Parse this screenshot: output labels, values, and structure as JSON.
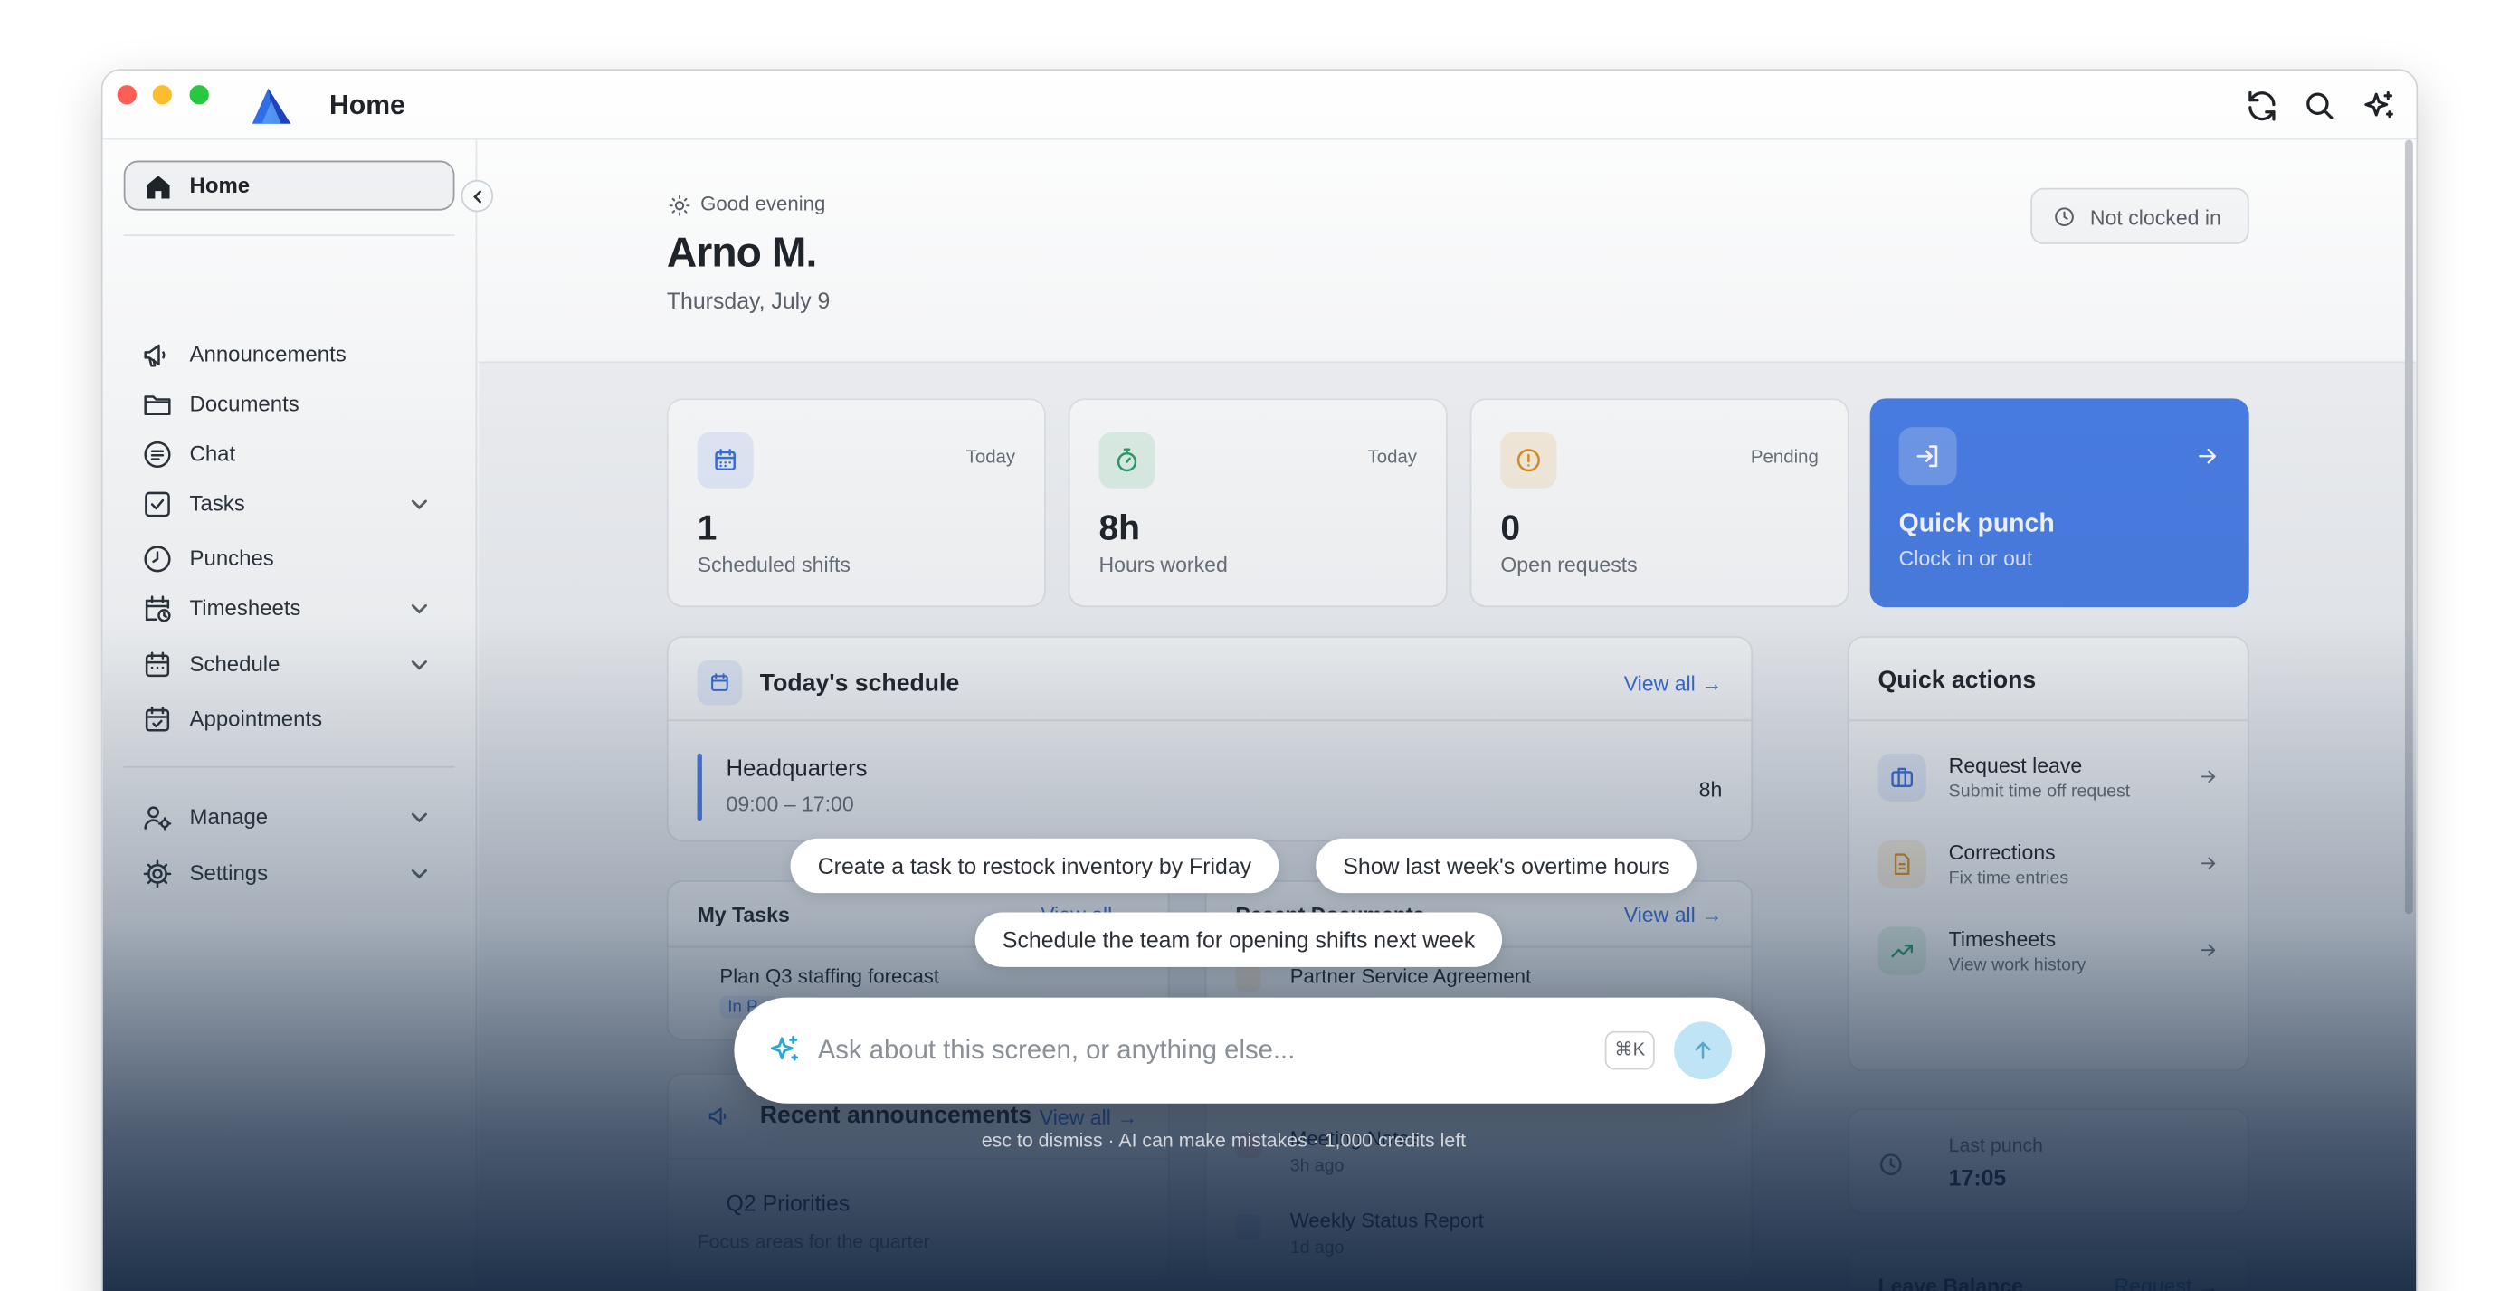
{
  "app": {
    "title": "Home"
  },
  "sidebar": {
    "home_label": "Home",
    "items": [
      {
        "label": "Announcements",
        "icon": "megaphone-icon",
        "expandable": false
      },
      {
        "label": "Documents",
        "icon": "folder-icon",
        "expandable": false
      },
      {
        "label": "Chat",
        "icon": "chat-icon",
        "expandable": false
      },
      {
        "label": "Tasks",
        "icon": "checkbox-icon",
        "expandable": true
      },
      {
        "label": "Punches",
        "icon": "clock-icon",
        "expandable": false
      },
      {
        "label": "Timesheets",
        "icon": "calendar-clock-icon",
        "expandable": true
      },
      {
        "label": "Schedule",
        "icon": "calendar-icon",
        "expandable": true
      },
      {
        "label": "Appointments",
        "icon": "calendar-check-icon",
        "expandable": false
      }
    ],
    "secondary": [
      {
        "label": "Manage",
        "icon": "users-gear-icon",
        "expandable": true
      },
      {
        "label": "Settings",
        "icon": "gear-icon",
        "expandable": true
      }
    ]
  },
  "header": {
    "greeting": "Good evening",
    "user_name": "Arno M.",
    "date": "Thursday, July 9",
    "clock_status": "Not clocked in"
  },
  "stats": [
    {
      "value": "1",
      "caption": "Scheduled shifts",
      "tag": "Today",
      "icon": "calendar-icon",
      "color": "#3b6fd8",
      "bg": "#e8eefc"
    },
    {
      "value": "8h",
      "caption": "Hours worked",
      "tag": "Today",
      "icon": "stopwatch-icon",
      "color": "#2e9e6a",
      "bg": "#e3f4ea"
    },
    {
      "value": "0",
      "caption": "Open requests",
      "tag": "Pending",
      "icon": "alert-circle-icon",
      "color": "#e0902a",
      "bg": "#fcf1e0"
    }
  ],
  "quick_punch": {
    "title": "Quick punch",
    "subtitle": "Clock in or out",
    "color": "#4a7fe8"
  },
  "schedule": {
    "title": "Today's schedule",
    "view_all": "View all",
    "shift": {
      "location": "Headquarters",
      "time": "09:00 – 17:00",
      "hours": "8h"
    }
  },
  "quick_actions": {
    "title": "Quick actions",
    "items": [
      {
        "title": "Request leave",
        "subtitle": "Submit time off request",
        "icon": "briefcase-icon"
      },
      {
        "title": "Corrections",
        "subtitle": "Fix time entries",
        "icon": "document-icon"
      },
      {
        "title": "Timesheets",
        "subtitle": "View work history",
        "icon": "trending-up-icon"
      }
    ]
  },
  "my_tasks": {
    "title": "My Tasks",
    "view_all": "View all",
    "items": [
      {
        "title": "Plan Q3 staffing forecast",
        "status": "In P..."
      }
    ]
  },
  "recent_documents": {
    "title": "Recent Documents",
    "view_all": "View all",
    "items": [
      {
        "title": "Partner Service Agreement"
      },
      {
        "title": "Meeting Notes",
        "meta": "3h ago"
      },
      {
        "title": "Weekly Status Report",
        "meta": "1d ago"
      }
    ]
  },
  "announcements": {
    "title": "Recent announcements",
    "view_all": "View all",
    "items": [
      {
        "title": "Q2 Priorities",
        "excerpt": "Focus areas for the quarter"
      }
    ]
  },
  "last_punch": {
    "label": "Last punch",
    "time": "17:05"
  },
  "leave_balance": {
    "title": "Leave Balance",
    "action": "Request"
  },
  "ai": {
    "suggestions": [
      "Create a task to restock inventory by Friday",
      "Show last week's overtime hours",
      "Schedule the team for opening shifts next week"
    ],
    "placeholder": "Ask about this screen, or anything else...",
    "shortcut": "⌘K",
    "hint": "esc to dismiss · AI can make mistakes · 1,000 credits left",
    "accent": "#2aa8d8"
  }
}
